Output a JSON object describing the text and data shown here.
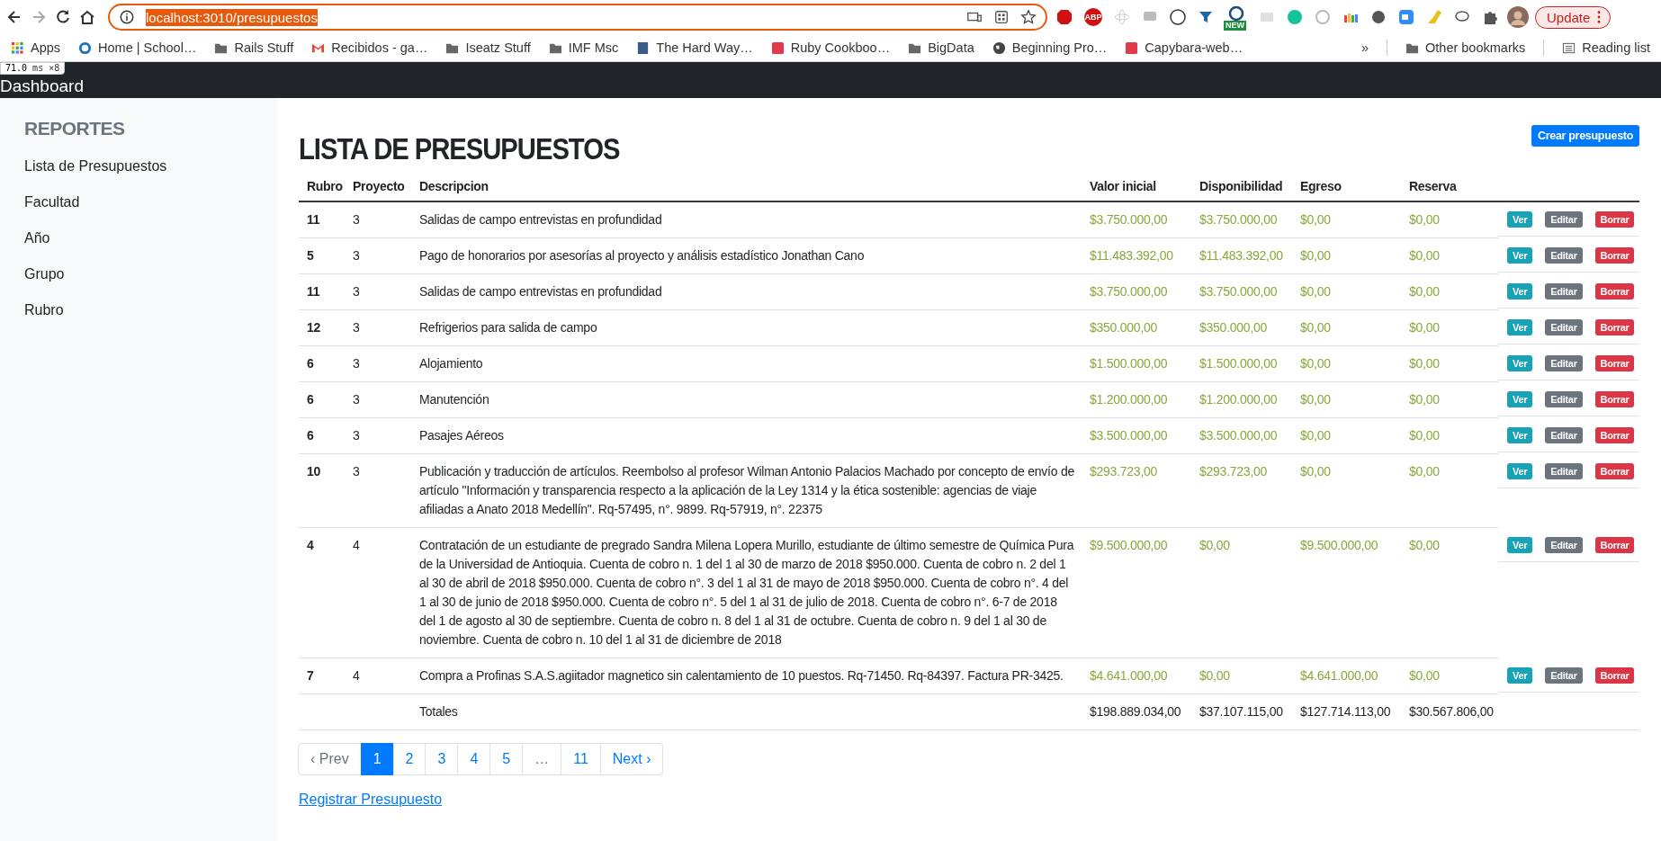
{
  "browser": {
    "url": "localhost:3010/presupuestos",
    "abp_label": "ABP",
    "new_badge": "NEW",
    "update_button": "Update"
  },
  "bookmarks": [
    {
      "label": "Apps",
      "kind": "grid"
    },
    {
      "label": "Home | School…",
      "kind": "site"
    },
    {
      "label": "Rails Stuff",
      "kind": "folder"
    },
    {
      "label": "Recibidos - ga…",
      "kind": "mail"
    },
    {
      "label": "Iseatz Stuff",
      "kind": "folder"
    },
    {
      "label": "IMF Msc",
      "kind": "folder"
    },
    {
      "label": "The Hard Way…",
      "kind": "page"
    },
    {
      "label": "Ruby Cookboo…",
      "kind": "tile"
    },
    {
      "label": "BigData",
      "kind": "folder"
    },
    {
      "label": "Beginning Pro…",
      "kind": "globe"
    },
    {
      "label": "Capybara-web…",
      "kind": "tile"
    }
  ],
  "bookmarks_more": "»",
  "other_bookmarks": "Other bookmarks",
  "reading_list": "Reading list",
  "perf_overlay": {
    "value": "71.0",
    "unit": "ms ×8"
  },
  "navbar": {
    "brand": "Dashboard"
  },
  "sidebar": {
    "heading": "REPORTES",
    "items": [
      {
        "label": "Lista de Presupuestos"
      },
      {
        "label": "Facultad"
      },
      {
        "label": "Año"
      },
      {
        "label": "Grupo"
      },
      {
        "label": "Rubro"
      }
    ]
  },
  "page": {
    "title": "LISTA DE PRESUPUESTOS",
    "create_button": "Crear presupuesto"
  },
  "table": {
    "columns": [
      "Rubro",
      "Proyecto",
      "Descripcion",
      "Valor inicial",
      "Disponibilidad",
      "Egreso",
      "Reserva"
    ],
    "rows": [
      {
        "rubro": "11",
        "proyecto": "3",
        "descripcion": "Salidas de campo entrevistas en profundidad",
        "valor_inicial": "$3.750.000,00",
        "disponibilidad": "$3.750.000,00",
        "egreso": "$0,00",
        "reserva": "$0,00",
        "actions": [
          {
            "label": "Ver",
            "kind": "view"
          },
          {
            "label": "Editar",
            "kind": "edit"
          },
          {
            "label": "Borrar",
            "kind": "delete"
          }
        ]
      },
      {
        "rubro": "5",
        "proyecto": "3",
        "descripcion": "Pago de honorarios por asesorías al proyecto y análisis estadístico Jonathan Cano",
        "valor_inicial": "$11.483.392,00",
        "disponibilidad": "$11.483.392,00",
        "egreso": "$0,00",
        "reserva": "$0,00",
        "actions": [
          {
            "label": "Ver",
            "kind": "view"
          },
          {
            "label": "Editar",
            "kind": "edit"
          },
          {
            "label": "Borrar",
            "kind": "delete"
          }
        ]
      },
      {
        "rubro": "11",
        "proyecto": "3",
        "descripcion": "Salidas de campo entrevistas en profundidad",
        "valor_inicial": "$3.750.000,00",
        "disponibilidad": "$3.750.000,00",
        "egreso": "$0,00",
        "reserva": "$0,00",
        "actions": [
          {
            "label": "Ver",
            "kind": "view"
          },
          {
            "label": "Editar",
            "kind": "edit"
          },
          {
            "label": "Borrar",
            "kind": "delete"
          }
        ]
      },
      {
        "rubro": "12",
        "proyecto": "3",
        "descripcion": "Refrigerios para salida de campo",
        "valor_inicial": "$350.000,00",
        "disponibilidad": "$350.000,00",
        "egreso": "$0,00",
        "reserva": "$0,00",
        "actions": [
          {
            "label": "Ver",
            "kind": "view"
          },
          {
            "label": "Editar",
            "kind": "edit"
          },
          {
            "label": "Borrar",
            "kind": "delete"
          }
        ]
      },
      {
        "rubro": "6",
        "proyecto": "3",
        "descripcion": "Alojamiento",
        "valor_inicial": "$1.500.000,00",
        "disponibilidad": "$1.500.000,00",
        "egreso": "$0,00",
        "reserva": "$0,00",
        "actions": [
          {
            "label": "Ver",
            "kind": "view"
          },
          {
            "label": "Editar",
            "kind": "edit"
          },
          {
            "label": "Borrar",
            "kind": "delete"
          }
        ]
      },
      {
        "rubro": "6",
        "proyecto": "3",
        "descripcion": "Manutención",
        "valor_inicial": "$1.200.000,00",
        "disponibilidad": "$1.200.000,00",
        "egreso": "$0,00",
        "reserva": "$0,00",
        "actions": [
          {
            "label": "Ver",
            "kind": "view"
          },
          {
            "label": "Editar",
            "kind": "edit"
          },
          {
            "label": "Borrar",
            "kind": "delete"
          }
        ]
      },
      {
        "rubro": "6",
        "proyecto": "3",
        "descripcion": "Pasajes Aéreos",
        "valor_inicial": "$3.500.000,00",
        "disponibilidad": "$3.500.000,00",
        "egreso": "$0,00",
        "reserva": "$0,00",
        "actions": [
          {
            "label": "Ver",
            "kind": "view"
          },
          {
            "label": "Editar",
            "kind": "edit"
          },
          {
            "label": "Borrar",
            "kind": "delete"
          }
        ]
      },
      {
        "rubro": "10",
        "proyecto": "3",
        "descripcion": "Publicación y traducción de artículos. Reembolso al profesor Wilman Antonio Palacios Machado por concepto de envío de artículo \"Información y transparencia respecto a la aplicación de la Ley 1314 y la ética sostenible: agencias de viaje afiliadas a Anato 2018 Medellín\". Rq-57495, n°. 9899. Rq-57919, n°. 22375",
        "valor_inicial": "$293.723,00",
        "disponibilidad": "$293.723,00",
        "egreso": "$0,00",
        "reserva": "$0,00",
        "actions": [
          {
            "label": "Ver",
            "kind": "view"
          },
          {
            "label": "Editar",
            "kind": "edit"
          },
          {
            "label": "Borrar",
            "kind": "delete"
          }
        ]
      },
      {
        "rubro": "4",
        "proyecto": "4",
        "descripcion": "Contratación de un estudiante de pregrado Sandra Milena Lopera Murillo, estudiante de último semestre de Química Pura de la Universidad de Antioquia. Cuenta de cobro n. 1 del 1 al 30 de marzo de 2018 $950.000. Cuenta de cobro n. 2 del 1 al 30 de abril de 2018 $950.000. Cuenta de cobro n°. 3 del 1 al 31 de mayo de 2018 $950.000. Cuenta de cobro n°. 4 del 1 al 30 de junio de 2018 $950.000. Cuenta de cobro n°. 5 del 1 al 31 de julio de 2018. Cuenta de cobro n°. 6-7 de 2018 del 1 de agosto al 30 de septiembre. Cuenta de cobro n. 8 del 1 al 31 de octubre. Cuenta de cobro n. 9 del 1 al 30 de noviembre. Cuenta de cobro n. 10 del 1 al 31 de diciembre de 2018",
        "valor_inicial": "$9.500.000,00",
        "disponibilidad": "$0,00",
        "egreso": "$9.500.000,00",
        "reserva": "$0,00",
        "actions": [
          {
            "label": "Ver",
            "kind": "view"
          },
          {
            "label": "Editar",
            "kind": "edit"
          },
          {
            "label": "Borrar",
            "kind": "delete"
          }
        ]
      },
      {
        "rubro": "7",
        "proyecto": "4",
        "descripcion": "Compra a Profinas S.A.S.agiitador magnetico sin calentamiento de 10 puestos. Rq-71450. Rq-84397. Factura PR-3425.",
        "valor_inicial": "$4.641.000,00",
        "disponibilidad": "$0,00",
        "egreso": "$4.641.000,00",
        "reserva": "$0,00",
        "actions": [
          {
            "label": "Ver",
            "kind": "view"
          },
          {
            "label": "Editar",
            "kind": "edit"
          },
          {
            "label": "Borrar",
            "kind": "delete"
          }
        ]
      }
    ],
    "totals": {
      "label": "Totales",
      "valor_inicial": "$198.889.034,00",
      "disponibilidad": "$37.107.115,00",
      "egreso": "$127.714.113,00",
      "reserva": "$30.567.806,00"
    }
  },
  "pagination": [
    {
      "label": "‹ Prev",
      "selected": false,
      "disabled": true
    },
    {
      "label": "1",
      "selected": true,
      "disabled": false
    },
    {
      "label": "2",
      "selected": false,
      "disabled": false
    },
    {
      "label": "3",
      "selected": false,
      "disabled": false
    },
    {
      "label": "4",
      "selected": false,
      "disabled": false
    },
    {
      "label": "5",
      "selected": false,
      "disabled": false
    },
    {
      "label": "…",
      "selected": false,
      "disabled": true
    },
    {
      "label": "11",
      "selected": false,
      "disabled": false
    },
    {
      "label": "Next ›",
      "selected": false,
      "disabled": false
    }
  ],
  "register_link": "Registrar Presupuesto"
}
